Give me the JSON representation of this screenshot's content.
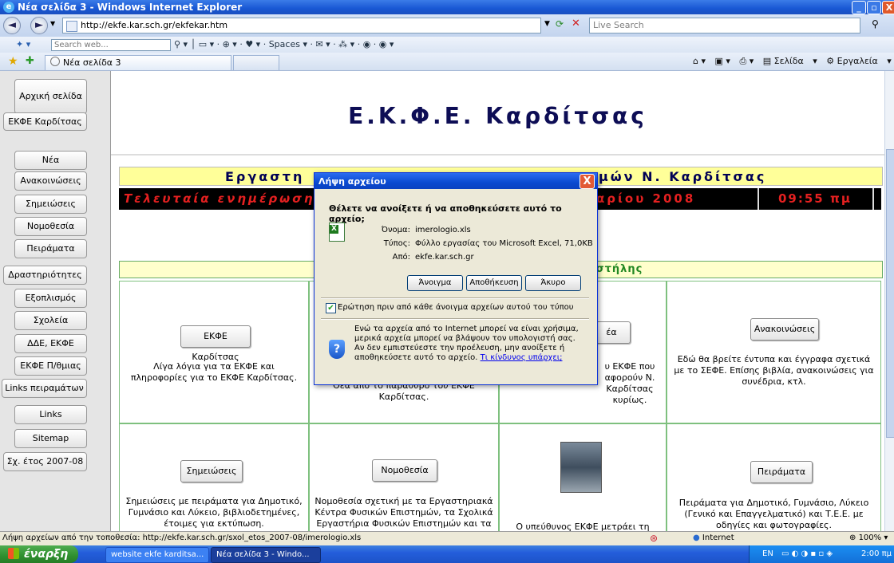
{
  "window": {
    "title": "Νέα σελίδα 3 - Windows Internet Explorer"
  },
  "address": {
    "url": "http://ekfe.kar.sch.gr/ekfekar.htm",
    "search_placeholder": "Live Search"
  },
  "toolbar": {
    "search_placeholder": "Search web...",
    "spaces_label": "Spaces"
  },
  "tab": {
    "label": "Νέα σελίδα 3"
  },
  "commandbar": {
    "page_label": "Σελίδα",
    "tools_label": "Εργαλεία"
  },
  "nav": {
    "items": [
      "Αρχική σελίδα",
      "ΕΚΦΕ Καρδίτσας",
      "Νέα",
      "Ανακοινώσεις",
      "Σημειώσεις",
      "Νομοθεσία",
      "Πειράματα",
      "Δραστηριότητες",
      "Εξοπλισμός",
      "Σχολεία",
      "ΔΔΕ, ΕΚΦΕ",
      "ΕΚΦΕ Π/θμιας",
      "Links πειραμάτων",
      "Links",
      "Sitemap",
      "Σχ. έτος 2007-08"
    ]
  },
  "page": {
    "title": "Ε.Κ.Φ.Ε. Καρδίτσας",
    "banner_left": "Εργαστη",
    "banner_right": "μών Ν. Καρδίτσας",
    "update_label": "Τελευταία ενημέρωση:",
    "update_date_fragment": "αρίου 2008",
    "update_time": "09:55 πμ",
    "section_header_fragment": "ής στήλης"
  },
  "cells": [
    {
      "button": "ΕΚΦΕ Καρδίτσας",
      "text": "Λίγα λόγια για τα ΕΚΦΕ και πληροφορίες για το ΕΚΦΕ Καρδίτσας."
    },
    {
      "button": "",
      "text": "Θέα από το παράθυρο του ΕΚΦΕ Καρδίτσας."
    },
    {
      "button": "έα",
      "text": "υ ΕΚΦΕ που αφορούν Ν. Καρδίτσας κυρίως."
    },
    {
      "button": "Ανακοινώσεις",
      "text": "Εδώ θα βρείτε έντυπα και έγγραφα σχετικά με το ΣΕΦΕ. Επίσης βιβλία, ανακοινώσεις για συνέδρια, κτλ."
    },
    {
      "button": "Σημειώσεις",
      "text": "Σημειώσεις με πειράματα για Δημοτικό, Γυμνάσιο και Λύκειο, βιβλιοδετημένες, έτοιμες για εκτύπωση."
    },
    {
      "button": "Νομοθεσία",
      "text": "Νομοθεσία σχετική με τα Εργαστηριακά Κέντρα Φυσικών Επιστημών, τα Σχολικά Εργαστήρια Φυσικών Επιστημών και τα ΣΕΚ."
    },
    {
      "button": "",
      "text": "Ο υπεύθυνος ΕΚΦΕ μετράει τη θερμότητα που"
    },
    {
      "button": "Πειράματα",
      "text": "Πειράματα για Δημοτικό, Γυμνάσιο, Λύκειο (Γενικό και Επαγγελματικό) και Τ.Ε.Ε. με οδηγίες και φωτογραφίες."
    }
  ],
  "dialog": {
    "title": "Λήψη αρχείου",
    "question": "Θέλετε να ανοίξετε ή να αποθηκεύσετε αυτό το αρχείο;",
    "name_label": "Όνομα:",
    "name_value": "imerologio.xls",
    "type_label": "Τύπος:",
    "type_value": "Φύλλο εργασίας του Microsoft Excel, 71,0KB",
    "from_label": "Από:",
    "from_value": "ekfe.kar.sch.gr",
    "open_button": "Άνοιγμα",
    "save_button": "Αποθήκευση",
    "cancel_button": "Άκυρο",
    "checkbox_label": "Ερώτηση πριν από κάθε άνοιγμα αρχείων αυτού του τύπου",
    "warning_text": "Ενώ τα αρχεία από το Internet μπορεί να είναι χρήσιμα, μερικά αρχεία μπορεί να βλάψουν τον υπολογιστή σας. Αν δεν εμπιστεύεστε την προέλευση, μην ανοίξετε ή αποθηκεύσετε αυτό το αρχείο.",
    "risk_link": "Τι κίνδυνος υπάρχει;"
  },
  "status": {
    "text": "Λήψη αρχείων από την τοποθεσία: http://ekfe.kar.sch.gr/sxol_etos_2007-08/imerologio.xls",
    "zone": "Internet",
    "zoom": "100%"
  },
  "taskbar": {
    "start": "έναρξη",
    "tasks": [
      "website ekfe karditsa...",
      "Νέα σελίδα 3 - Windo..."
    ],
    "lang": "EN",
    "clock": "2:00 πμ"
  }
}
